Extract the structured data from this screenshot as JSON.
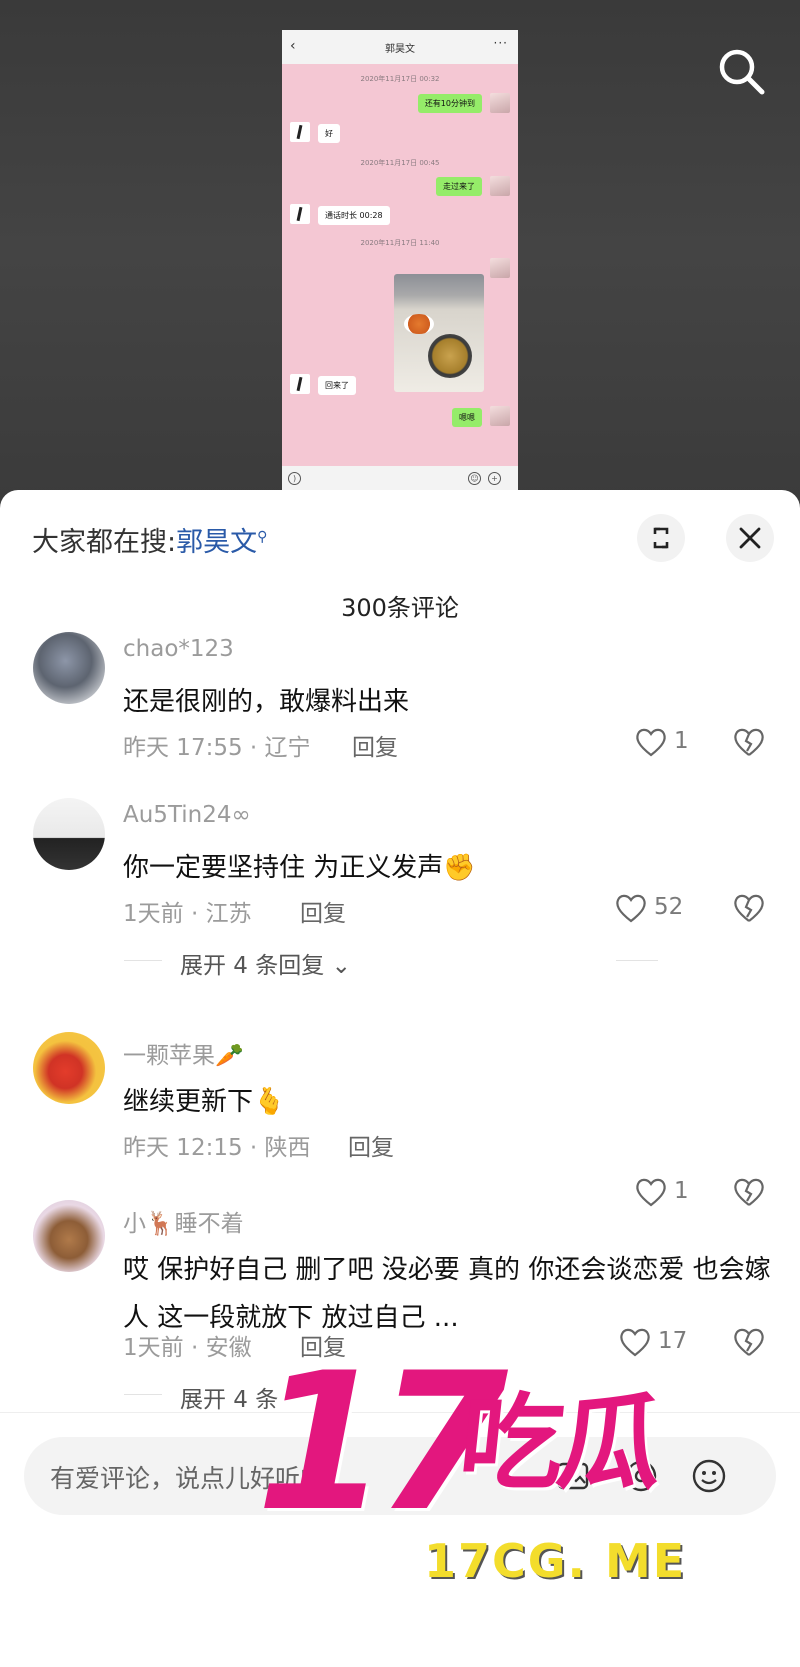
{
  "phone_shot": {
    "title": "郭昊文",
    "back_icon": "chevron-left-icon",
    "more_icon": "more-dots-icon",
    "timestamps": [
      "2020年11月17日 00:32",
      "2020年11月17日 00:45",
      "2020年11月17日 11:40"
    ],
    "msg_me_1": "还有10分钟到",
    "msg_him_1": "好",
    "msg_me_2": "走过来了",
    "msg_him_call": "通话时长 00:28",
    "msg_him_2": "回来了",
    "msg_me_3": "嗯嗯",
    "bar_colors": {
      "bubble_me": "#95ec69",
      "bubble_him": "#ffffff",
      "chat_bg": "#f4c7d3"
    }
  },
  "top": {
    "search_icon": "search-icon"
  },
  "sheet": {
    "hot_prefix": "大家都在搜:",
    "hot_term": "郭昊文",
    "hot_icon": "search-small-icon",
    "expand_icon": "expand-icon",
    "close_icon": "close-icon",
    "count": "300条评论"
  },
  "comments": [
    {
      "name": "chao*123",
      "text": "还是很刚的，敢爆料出来",
      "meta": "昨天 17:55 · 辽宁",
      "reply": "回复",
      "likes": "1"
    },
    {
      "name": "Au5Tin24∞",
      "text": "你一定要坚持住 为正义发声✊",
      "meta": "1天前 · 江苏",
      "reply": "回复",
      "likes": "52",
      "expand": "展开 4 条回复"
    },
    {
      "name": "一颗苹果🥕",
      "text": "继续更新下🫰",
      "meta": "昨天 12:15 · 陕西",
      "reply": "回复",
      "likes": "1"
    },
    {
      "name": "小🦌睡不着",
      "text": "哎 保护好自己 删了吧 没必要 真的 你还会谈恋爱 也会嫁人 这一段就放下 放过自己 ...",
      "meta": "1天前 · 安徽",
      "reply": "回复",
      "likes": "17",
      "expand": "展开 4 条"
    }
  ],
  "input": {
    "placeholder": "有爱评论，说点儿好听的",
    "icons": [
      "image-icon",
      "at-icon",
      "emoji-icon"
    ]
  },
  "watermark": {
    "big": "17",
    "cn": "吃瓜",
    "url": "17CG. ME",
    "colors": {
      "pink": "#e3177e",
      "yellow": "#f3dd2c"
    }
  }
}
